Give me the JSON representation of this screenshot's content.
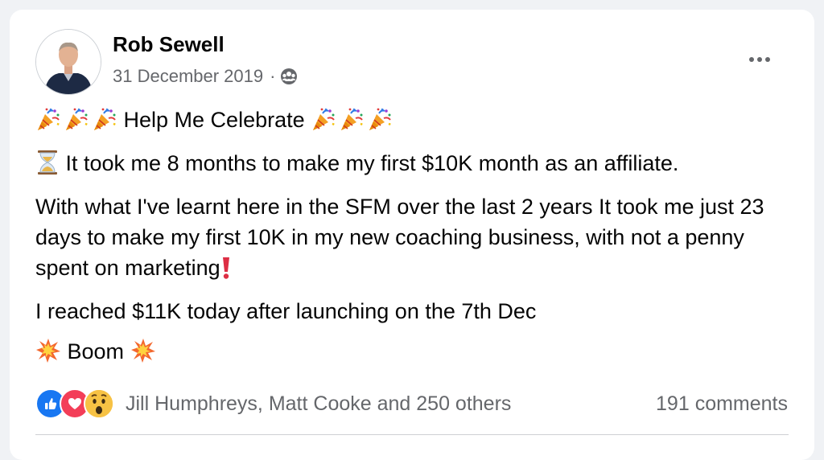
{
  "post": {
    "author": "Rob Sewell",
    "date": "31 December 2019",
    "separator": "·",
    "audience_icon": "group-audience-icon",
    "more_icon": "more-options-icon"
  },
  "content": {
    "line1": "Help Me Celebrate",
    "line2": "It took me 8 months to make my first $10K month as an affiliate.",
    "line3": "With what I've learnt here in the SFM over the last 2 years It took me just 23 days to make my first 10K in my new coaching business, with not a penny spent on marketing",
    "line4": "I reached $11K today after launching on the 7th Dec",
    "line5": "Boom"
  },
  "reactions": {
    "icons": [
      "like-icon",
      "love-icon",
      "wow-icon"
    ],
    "names": "Jill Humphreys, Matt Cooke and 250 others",
    "comments": "191 comments"
  },
  "colors": {
    "like": "#1877f2",
    "love": "#f33e58",
    "wow": "#f7b125",
    "secondary_text": "#65676b"
  }
}
